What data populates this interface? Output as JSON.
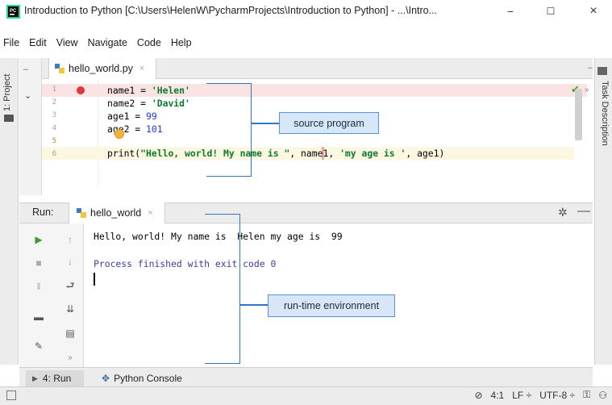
{
  "window": {
    "title": "Introduction to Python [C:\\Users\\HelenW\\PycharmProjects\\Introduction to Python] - ...\\Intro...",
    "minimize": "−",
    "maximize": "☐",
    "close": "×"
  },
  "menu": [
    "File",
    "Edit",
    "View",
    "Navigate",
    "Code",
    "Help"
  ],
  "sidebar": {
    "project_label": "1: Project",
    "task_label": "Task Description"
  },
  "editor": {
    "tab_label": "hello_world.py",
    "line_numbers": [
      "1",
      "2",
      "3",
      "4",
      "5",
      "6"
    ],
    "lines": [
      {
        "pre": "name1 = ",
        "str": "'Helen'",
        "post": ""
      },
      {
        "pre": "name2 = ",
        "str": "'David'",
        "post": ""
      },
      {
        "pre": "age1 = ",
        "num": "99"
      },
      {
        "pre": "age2 = ",
        "num": "101"
      },
      {
        "pre": "print(",
        "str1": "\"Hello, world! My name is \"",
        "mid": ", name1, ",
        "str2": "'my age is '",
        "post": ", age1)"
      },
      {
        "pre": ""
      }
    ]
  },
  "annotations": {
    "source": "source program",
    "runtime": "run-time environment"
  },
  "run": {
    "label": "Run:",
    "tab_label": "hello_world",
    "output_line": "Hello, world! My name is  Helen my age is  99",
    "finish_line": "Process finished with exit code 0"
  },
  "bottom_bar": {
    "run_label": "4: Run",
    "console_label": "Python Console"
  },
  "status": {
    "position": "4:1",
    "line_sep": "LF ÷",
    "encoding": "UTF-8 ÷"
  },
  "colors": {
    "accent": "#2e77c4",
    "annotation_fill": "#d8e7f8",
    "breakpoint": "#e03636"
  }
}
